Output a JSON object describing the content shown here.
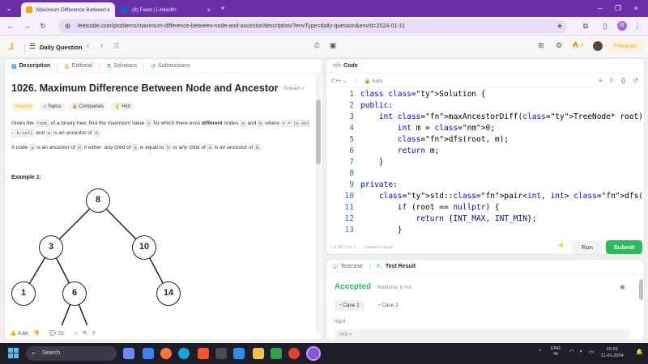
{
  "browser": {
    "tabs": [
      {
        "title": "Maximum Difference Between N"
      },
      {
        "title": "(8) Feed | LinkedIn"
      }
    ],
    "url": "leetcode.com/problems/maximum-difference-between-node-and-ancestor/description/?envType=daily-question&envId=2024-01-11",
    "profile_initial": "R"
  },
  "header": {
    "daily_label": "Daily Question",
    "streak": "4",
    "premium_label": "Premium"
  },
  "left_tabs": [
    "Description",
    "Editorial",
    "Solutions",
    "Submissions"
  ],
  "problem": {
    "title": "1026. Maximum Difference Between Node and Ancestor",
    "status": "Solved",
    "tags": [
      "Medium",
      "Topics",
      "Companies",
      "Hint"
    ],
    "p1": {
      "a": "Given the",
      "c1": "root",
      "b": "of a binary tree, find the maximum value",
      "c2": "v",
      "c": "for which there exist",
      "bold": "different",
      "d": "nodes",
      "c3": "a",
      "e": "and",
      "c4": "b",
      "f": "where",
      "c5": "v = |a.val - b.val|",
      "g": "and",
      "c6": "a",
      "h": "is an ancestor of",
      "c7": "b",
      "i": "."
    },
    "p2": {
      "a": "A node",
      "c1": "a",
      "b": "is an ancestor of",
      "c2": "b",
      "c": "if either: any child of",
      "c3": "a",
      "d": "is equal to",
      "c4": "b",
      "e": "or any child of",
      "c5": "a",
      "f": "is an ancestor of",
      "c6": "b",
      "g": "."
    },
    "example_label": "Example 1:",
    "tree_nodes": [
      "8",
      "3",
      "10",
      "1",
      "6",
      "14"
    ],
    "likes": "4.6K",
    "comments": "73"
  },
  "code_panel": {
    "title": "Code",
    "language": "C++",
    "mode": "Auto",
    "lines": [
      "class Solution {",
      "public:",
      "    int maxAncestorDiff(TreeNode* root) {",
      "        int m = 0;",
      "        dfs(root, m);",
      "        return m;",
      "    }",
      "",
      "private:",
      "    std::pair<int, int> dfs(TreeNode* root, int& m) {",
      "        if (root == nullptr) {",
      "            return {INT_MAX, INT_MIN};",
      "        }"
    ],
    "cursor": "Ln 28, Col 1",
    "saved": "Saved to local",
    "run_label": "Run",
    "submit_label": "Submit"
  },
  "test_panel": {
    "tabs": [
      "Testcase",
      "Test Result"
    ],
    "result": "Accepted",
    "runtime": "Runtime: 0 ms",
    "cases": [
      "Case 1",
      "Case 2"
    ],
    "input_label": "Input",
    "input_value": "root ="
  },
  "taskbar": {
    "search_placeholder": "Search",
    "lang1": "ENG",
    "lang2": "IN",
    "time": "15:56",
    "date": "11-01-2024"
  },
  "colors": {
    "tabstrip": "#6b2fa8",
    "accent_green": "#2cbb5d",
    "medium_orange": "#ffb800",
    "premium": "#ffa116"
  }
}
